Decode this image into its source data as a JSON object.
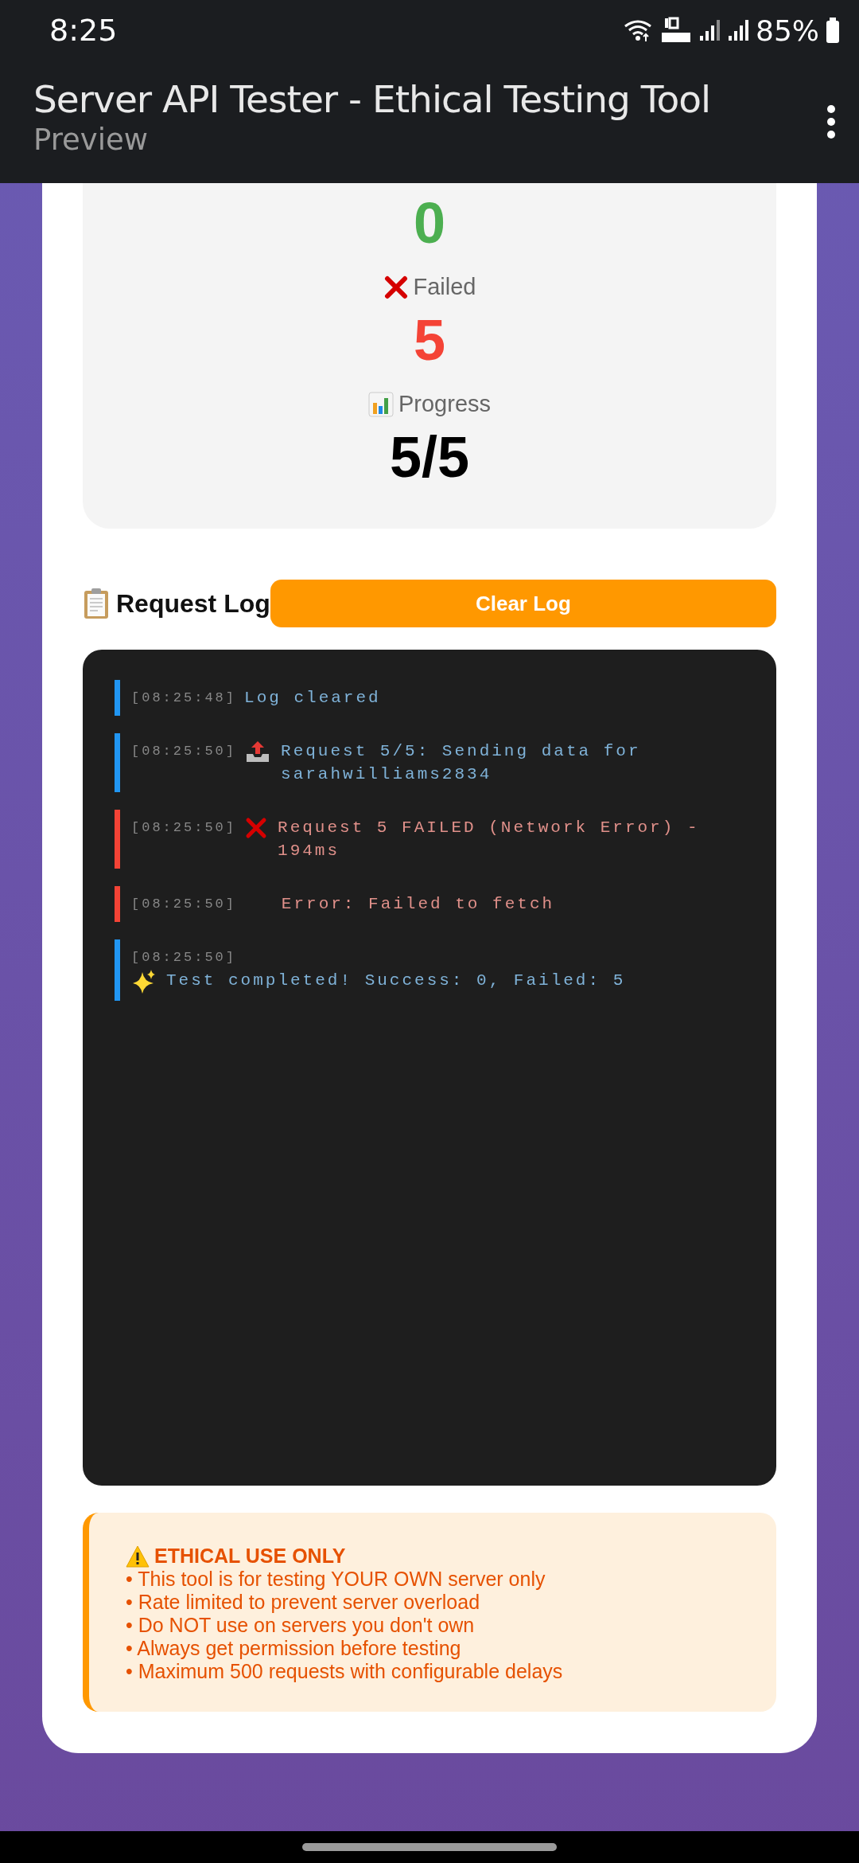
{
  "status_bar": {
    "time": "8:25",
    "battery": "85%"
  },
  "app_bar": {
    "title": "Server API Tester - Ethical Testing Tool",
    "subtitle": "Preview"
  },
  "stats": [
    {
      "kind": "success",
      "value": "0"
    },
    {
      "kind": "failed",
      "label": "Failed",
      "value": "5"
    },
    {
      "kind": "progress",
      "label": "Progress",
      "value": "5/5"
    }
  ],
  "request_log": {
    "title": "Request Log",
    "clear_button": "Clear Log",
    "entries": [
      {
        "kind": "info",
        "time": "[08:25:48]",
        "message": "Log cleared"
      },
      {
        "kind": "upload",
        "time": "[08:25:50]",
        "message": "Request 5/5: Sending data for sarahwilliams2834"
      },
      {
        "kind": "failure",
        "time": "[08:25:50]",
        "message": "Request 5 FAILED (Network Error) - 194ms"
      },
      {
        "kind": "error",
        "time": "[08:25:50]",
        "message": "   Error: Failed to fetch"
      },
      {
        "kind": "done",
        "time": "[08:25:50]",
        "message": "Test completed! Success: 0, Failed: 5"
      }
    ]
  },
  "warning": {
    "title": "ETHICAL USE ONLY",
    "items": [
      "• This tool is for testing YOUR OWN server only",
      "• Rate limited to prevent server overload",
      "• Do NOT use on servers you don't own",
      "• Always get permission before testing",
      "• Maximum 500 requests with configurable delays"
    ]
  }
}
